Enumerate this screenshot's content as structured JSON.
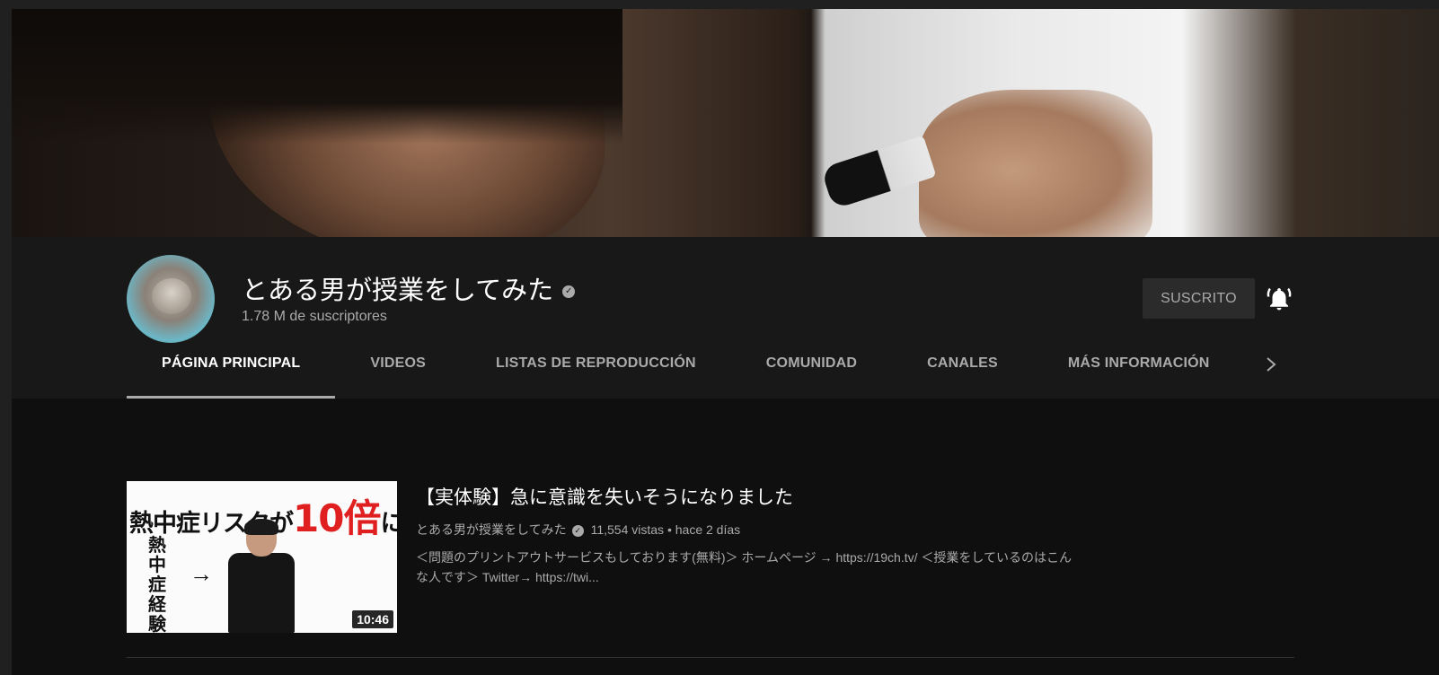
{
  "channel": {
    "name": "とある男が授業をしてみた",
    "subscribers": "1.78 M de suscriptores",
    "subscribe_label": "SUSCRITO"
  },
  "tabs": [
    {
      "label": "PÁGINA PRINCIPAL",
      "active": true
    },
    {
      "label": "VIDEOS"
    },
    {
      "label": "LISTAS DE REPRODUCCIÓN"
    },
    {
      "label": "COMUNIDAD"
    },
    {
      "label": "CANALES"
    },
    {
      "label": "MÁS INFORMACIÓN"
    }
  ],
  "featured_video": {
    "title": "【実体験】急に意識を失いそうになりました",
    "channel": "とある男が授業をしてみた",
    "views": "11,554 vistas",
    "separator": "•",
    "age": "hace 2 días",
    "description": "＜問題のプリントアウトサービスもしております(無料)＞ ホームページ → https://19ch.tv/ ＜授業をしているのはこんな人です＞ Twitter→ https://twi...",
    "duration": "10:46",
    "thumbnail": {
      "headline_prefix": "熱中症リスクが",
      "headline_highlight": "10倍",
      "headline_suffix": "に",
      "vertical_text": "熱中症経験者",
      "arrow": "→"
    }
  },
  "colors": {
    "background": "#0f0f0f",
    "header_bg": "#181818",
    "secondary_text": "#aaaaaa",
    "accent_red": "#e02020"
  },
  "icons": {
    "verified": "verified-check-icon",
    "bell": "bell-ringing-icon",
    "tabs_next": "chevron-right-icon"
  }
}
